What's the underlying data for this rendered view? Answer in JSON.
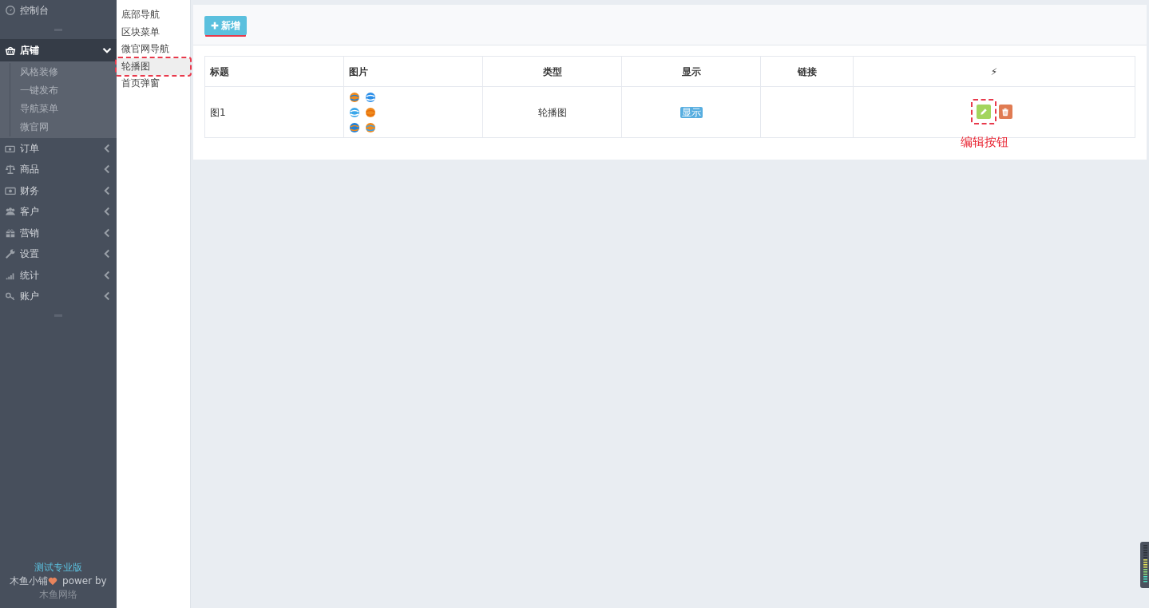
{
  "sidebar": {
    "items": [
      {
        "label": "控制台",
        "selected": false
      },
      {
        "label": "店铺",
        "expanded": true,
        "selected": true,
        "children": [
          {
            "label": "风格装修"
          },
          {
            "label": "一键发布"
          },
          {
            "label": "导航菜单"
          },
          {
            "label": "微官网"
          }
        ]
      },
      {
        "label": "订单",
        "expanded": false,
        "selected": false
      },
      {
        "label": "商品",
        "expanded": false,
        "selected": false
      },
      {
        "label": "财务",
        "expanded": false,
        "selected": false
      },
      {
        "label": "客户",
        "expanded": false,
        "selected": false
      },
      {
        "label": "营销",
        "expanded": false,
        "selected": false
      },
      {
        "label": "设置",
        "expanded": false,
        "selected": false
      },
      {
        "label": "统计",
        "expanded": false,
        "selected": false
      },
      {
        "label": "账户",
        "expanded": false,
        "selected": false
      }
    ],
    "footer": {
      "edition": "测试专业版",
      "brand": "木鱼小铺",
      "power": "power by",
      "company": "木鱼网络"
    }
  },
  "subnav": [
    {
      "label": "底部导航",
      "selected": false,
      "annotated": false
    },
    {
      "label": "区块菜单",
      "selected": false,
      "annotated": false
    },
    {
      "label": "微官网导航",
      "selected": false,
      "annotated": false
    },
    {
      "label": "轮播图",
      "selected": true,
      "annotated": true
    },
    {
      "label": "首页弹窗",
      "selected": false,
      "annotated": false
    }
  ],
  "toolbar": {
    "add_button": {
      "label": "新增",
      "annotated": true
    }
  },
  "table": {
    "columns": [
      {
        "label": "标题"
      },
      {
        "label": "图片"
      },
      {
        "label": "类型"
      },
      {
        "label": "显示"
      },
      {
        "label": "链接"
      },
      {
        "label": "⚡"
      }
    ],
    "rows": [
      {
        "title": "图1",
        "type": "轮播图",
        "show": "显示",
        "edit_annotated": true
      }
    ]
  },
  "annotation": {
    "label": "编辑按钮"
  }
}
